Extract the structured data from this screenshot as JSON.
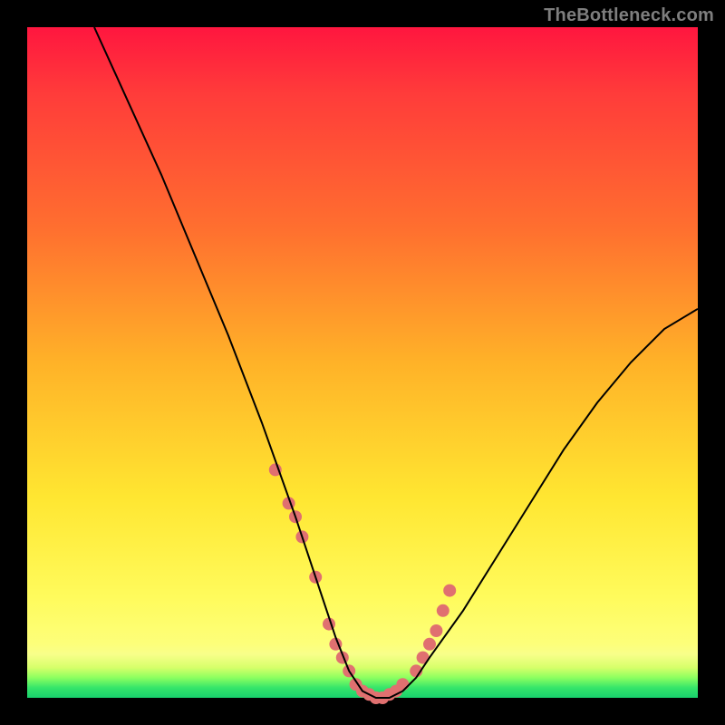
{
  "branding": "TheBottleneck.com",
  "chart_data": {
    "type": "line",
    "title": "",
    "xlabel": "",
    "ylabel": "",
    "xlim": [
      0,
      100
    ],
    "ylim": [
      0,
      100
    ],
    "series": [
      {
        "name": "curve",
        "x": [
          10,
          15,
          20,
          25,
          30,
          35,
          40,
          42,
          44,
          46,
          48,
          50,
          52,
          54,
          56,
          58,
          60,
          65,
          70,
          75,
          80,
          85,
          90,
          95,
          100
        ],
        "y": [
          100,
          89,
          78,
          66,
          54,
          41,
          27,
          21,
          15,
          9,
          4,
          1,
          0,
          0,
          1,
          3,
          6,
          13,
          21,
          29,
          37,
          44,
          50,
          55,
          58
        ],
        "color": "#000000",
        "stroke_width": 2
      },
      {
        "name": "highlight-dots",
        "x": [
          37,
          39,
          40,
          41,
          43,
          45,
          46,
          47,
          48,
          49,
          50,
          51,
          52,
          53,
          54,
          55,
          56,
          58,
          59,
          60,
          61,
          62,
          63
        ],
        "y": [
          34,
          29,
          27,
          24,
          18,
          11,
          8,
          6,
          4,
          2,
          1,
          0.5,
          0,
          0,
          0.5,
          1,
          2,
          4,
          6,
          8,
          10,
          13,
          16
        ],
        "color": "#e07070",
        "marker_radius": 7
      }
    ],
    "annotations": []
  }
}
